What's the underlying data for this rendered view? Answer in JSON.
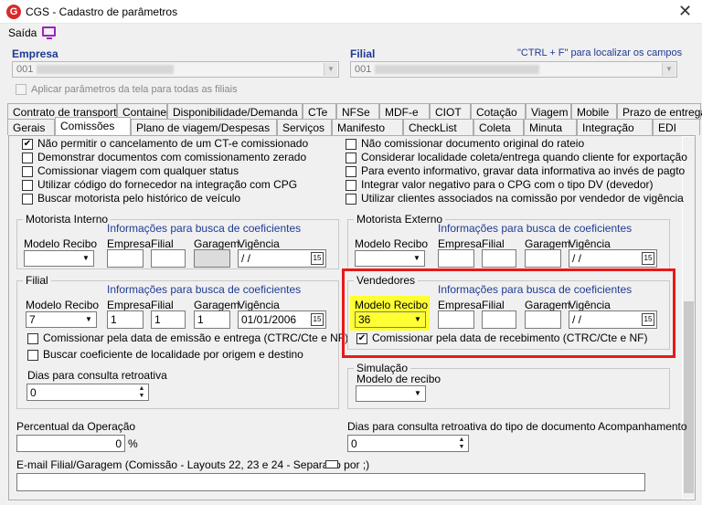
{
  "window": {
    "title": "CGS - Cadastro de parâmetros",
    "close": "✕"
  },
  "menu": {
    "saida": "Saída"
  },
  "empresa": {
    "label": "Empresa",
    "value": "001"
  },
  "filial": {
    "label": "Filial",
    "value": "001",
    "hint": "\"CTRL + F\" para localizar os campos"
  },
  "aplicar": "Aplicar parâmetros da tela para todas as filiais",
  "tabs_row1": [
    "Contrato de transporte",
    "Container",
    "Disponibilidade/Demanda",
    "CTe",
    "NFSe",
    "MDF-e",
    "CIOT",
    "Cotação",
    "Viagem",
    "Mobile",
    "Prazo de entrega"
  ],
  "tabs_row2": [
    "Gerais",
    "Comissões",
    "Plano de viagem/Despesas",
    "Serviços",
    "Manifesto",
    "CheckList",
    "Coleta",
    "Minuta",
    "Integração",
    "EDI"
  ],
  "left_options": [
    "Não permitir o cancelamento de um CT-e comissionado",
    "Demonstrar documentos com comissionamento zerado",
    "Comissionar viagem com qualquer status",
    "Utilizar código do fornecedor na integração com CPG",
    "Buscar motorista pelo histórico de veículo"
  ],
  "right_options": [
    "Não comissionar documento original do rateio",
    "Considerar localidade coleta/entrega quando cliente for exportação",
    "Para evento informativo, gravar data informativa ao invés de pagto",
    "Integrar valor negativo para o CPG com o tipo DV (devedor)",
    "Utilizar clientes associados na comissão por vendedor de vigência"
  ],
  "fields": {
    "info": "Informações para busca de coeficientes",
    "modelo_recibo": "Modelo Recibo",
    "empresa": "Empresa",
    "filial": "Filial",
    "garagem": "Garagem",
    "vigencia": "Vigência",
    "blank_date": " /  /",
    "cal_icon": "15"
  },
  "motorista_interno": {
    "title": "Motorista Interno"
  },
  "motorista_externo": {
    "title": "Motorista Externo"
  },
  "filial_group": {
    "title": "Filial",
    "modelo": "7",
    "empresa": "1",
    "filial": "1",
    "garagem": "1",
    "vigencia": "01/01/2006",
    "chk1": "Comissionar pela data de emissão e entrega (CTRC/Cte e NF)",
    "chk2": "Buscar coeficiente de localidade por origem e destino",
    "dias_label": "Dias para consulta retroativa",
    "dias_value": "0"
  },
  "vendedores": {
    "title": "Vendedores",
    "modelo": "36",
    "vigencia": " /  /",
    "chk": "Comissionar pela data de recebimento (CTRC/Cte e NF)",
    "checked": "✔"
  },
  "simulacao": {
    "title": "Simulação",
    "modelo_label": "Modelo de recibo"
  },
  "percentual": {
    "label": "Percentual da Operação",
    "value": "0",
    "unit": "%"
  },
  "dias_tipo": {
    "label": "Dias para consulta retroativa do tipo de documento Acompanhamento",
    "value": "0"
  },
  "email": {
    "label": "E-mail Filial/Garagem (Comissão - Layouts 22, 23 e 24 - Separado por ;)"
  },
  "colors": {
    "accent": "#1f3a93",
    "highlight_red": "#e8191a",
    "highlight_yellow": "#ffff33"
  }
}
